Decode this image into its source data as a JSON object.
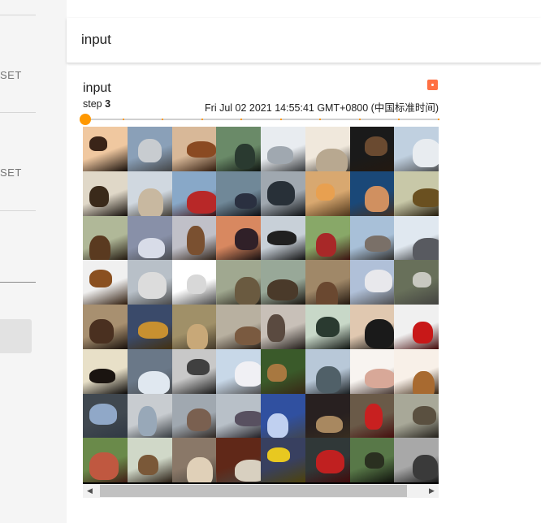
{
  "sidebar": {
    "labels": [
      "SET",
      "SET"
    ]
  },
  "header": {
    "title": "input"
  },
  "card": {
    "name": "input",
    "step_label": "step",
    "step_value": "3",
    "timestamp": "Fri Jul 02 2021 14:55:41 GMT+0800 (中国标准时间)",
    "slider": {
      "value": 0,
      "max": 16
    },
    "scrollbar": {
      "left_arrow": "◀",
      "right_arrow": "▶"
    }
  },
  "image_grid": {
    "rows": 8,
    "cols": 8,
    "cells": [
      [
        "#f0c8a0",
        "#3a2418"
      ],
      [
        "#8aa0b8",
        "#c8ccd0"
      ],
      [
        "#d8b898",
        "#8a4a22"
      ],
      [
        "#6a8a68",
        "#2a3a30"
      ],
      [
        "#e8ecf0",
        "#a0a8b0"
      ],
      [
        "#f0e8dc",
        "#b8a890"
      ],
      [
        "#1a1a1a",
        "#6a4a30"
      ],
      [
        "#c0d0e0",
        "#e8ecf0"
      ],
      [
        "#e0d8c8",
        "#3a2a1a"
      ],
      [
        "#d0d8e0",
        "#c8b8a0"
      ],
      [
        "#88a8c8",
        "#b82828"
      ],
      [
        "#708898",
        "#2a3040"
      ],
      [
        "#a0a8b0",
        "#283038"
      ],
      [
        "#d8a870",
        "#e8a050"
      ],
      [
        "#1a4878",
        "#d09060"
      ],
      [
        "#c8c8a8",
        "#6a5020"
      ],
      [
        "#b0b898",
        "#5a3a20"
      ],
      [
        "#8890a8",
        "#d8dce8"
      ],
      [
        "#c0c0c8",
        "#7a5030"
      ],
      [
        "#d88860",
        "#302028"
      ],
      [
        "#c8d0d8",
        "#202020"
      ],
      [
        "#88a868",
        "#a82828"
      ],
      [
        "#a8c0d8",
        "#7a7068"
      ],
      [
        "#e0e8f0",
        "#585a60"
      ],
      [
        "#f0f0f0",
        "#8a5020"
      ],
      [
        "#b8c0c8",
        "#dcdcdc"
      ],
      [
        "#ffffff",
        "#d8d8d8"
      ],
      [
        "#a0a890",
        "#6a5a40"
      ],
      [
        "#98a898",
        "#4a3a2a"
      ],
      [
        "#a08868",
        "#6a4830"
      ],
      [
        "#b0c0d8",
        "#e8e8ec"
      ],
      [
        "#68705a",
        "#c8c8c0"
      ],
      [
        "#a89070",
        "#4a3020"
      ],
      [
        "#3a4a6a",
        "#c89030"
      ],
      [
        "#a09068",
        "#c8a878"
      ],
      [
        "#b8b0a0",
        "#7a5a40"
      ],
      [
        "#c8c0b8",
        "#5a4a40"
      ],
      [
        "#c8d8c8",
        "#2a3a30"
      ],
      [
        "#e0c8b0",
        "#1a1a1a"
      ],
      [
        "#f0f0f0",
        "#c81818"
      ],
      [
        "#e8e0c8",
        "#1a1410"
      ],
      [
        "#6a7888",
        "#e0e8f0"
      ],
      [
        "#c8c8c8",
        "#404040"
      ],
      [
        "#c8d8e8",
        "#f0f0f4"
      ],
      [
        "#3a5a2a",
        "#a87840"
      ],
      [
        "#b8c8d8",
        "#506068"
      ],
      [
        "#f8f4f0",
        "#d8a898"
      ],
      [
        "#f8f0e8",
        "#a86a30"
      ],
      [
        "#404850",
        "#90a8c8"
      ],
      [
        "#c8ccd0",
        "#98a8b8"
      ],
      [
        "#a0a8b0",
        "#7a6050"
      ],
      [
        "#b8c0c8",
        "#585060"
      ],
      [
        "#3050a0",
        "#c0d0f0"
      ],
      [
        "#282020",
        "#a88860"
      ],
      [
        "#6a5a48",
        "#c82020"
      ],
      [
        "#a8a898",
        "#5a5040"
      ],
      [
        "#6a8a4a",
        "#c05840"
      ],
      [
        "#d0d8c8",
        "#7a5838"
      ],
      [
        "#8a7868",
        "#e0d0b8"
      ],
      [
        "#602818",
        "#d8d0c0"
      ],
      [
        "#384060",
        "#e8c820"
      ],
      [
        "#303838",
        "#c02020"
      ],
      [
        "#587848",
        "#2a3020"
      ],
      [
        "#a8a8a8",
        "#3a3a3a"
      ]
    ]
  },
  "colors": {
    "accent": "#ff9800",
    "badge": "#ff7043",
    "panel_bg": "#ffffff",
    "page_bg": "#f5f5f5"
  }
}
